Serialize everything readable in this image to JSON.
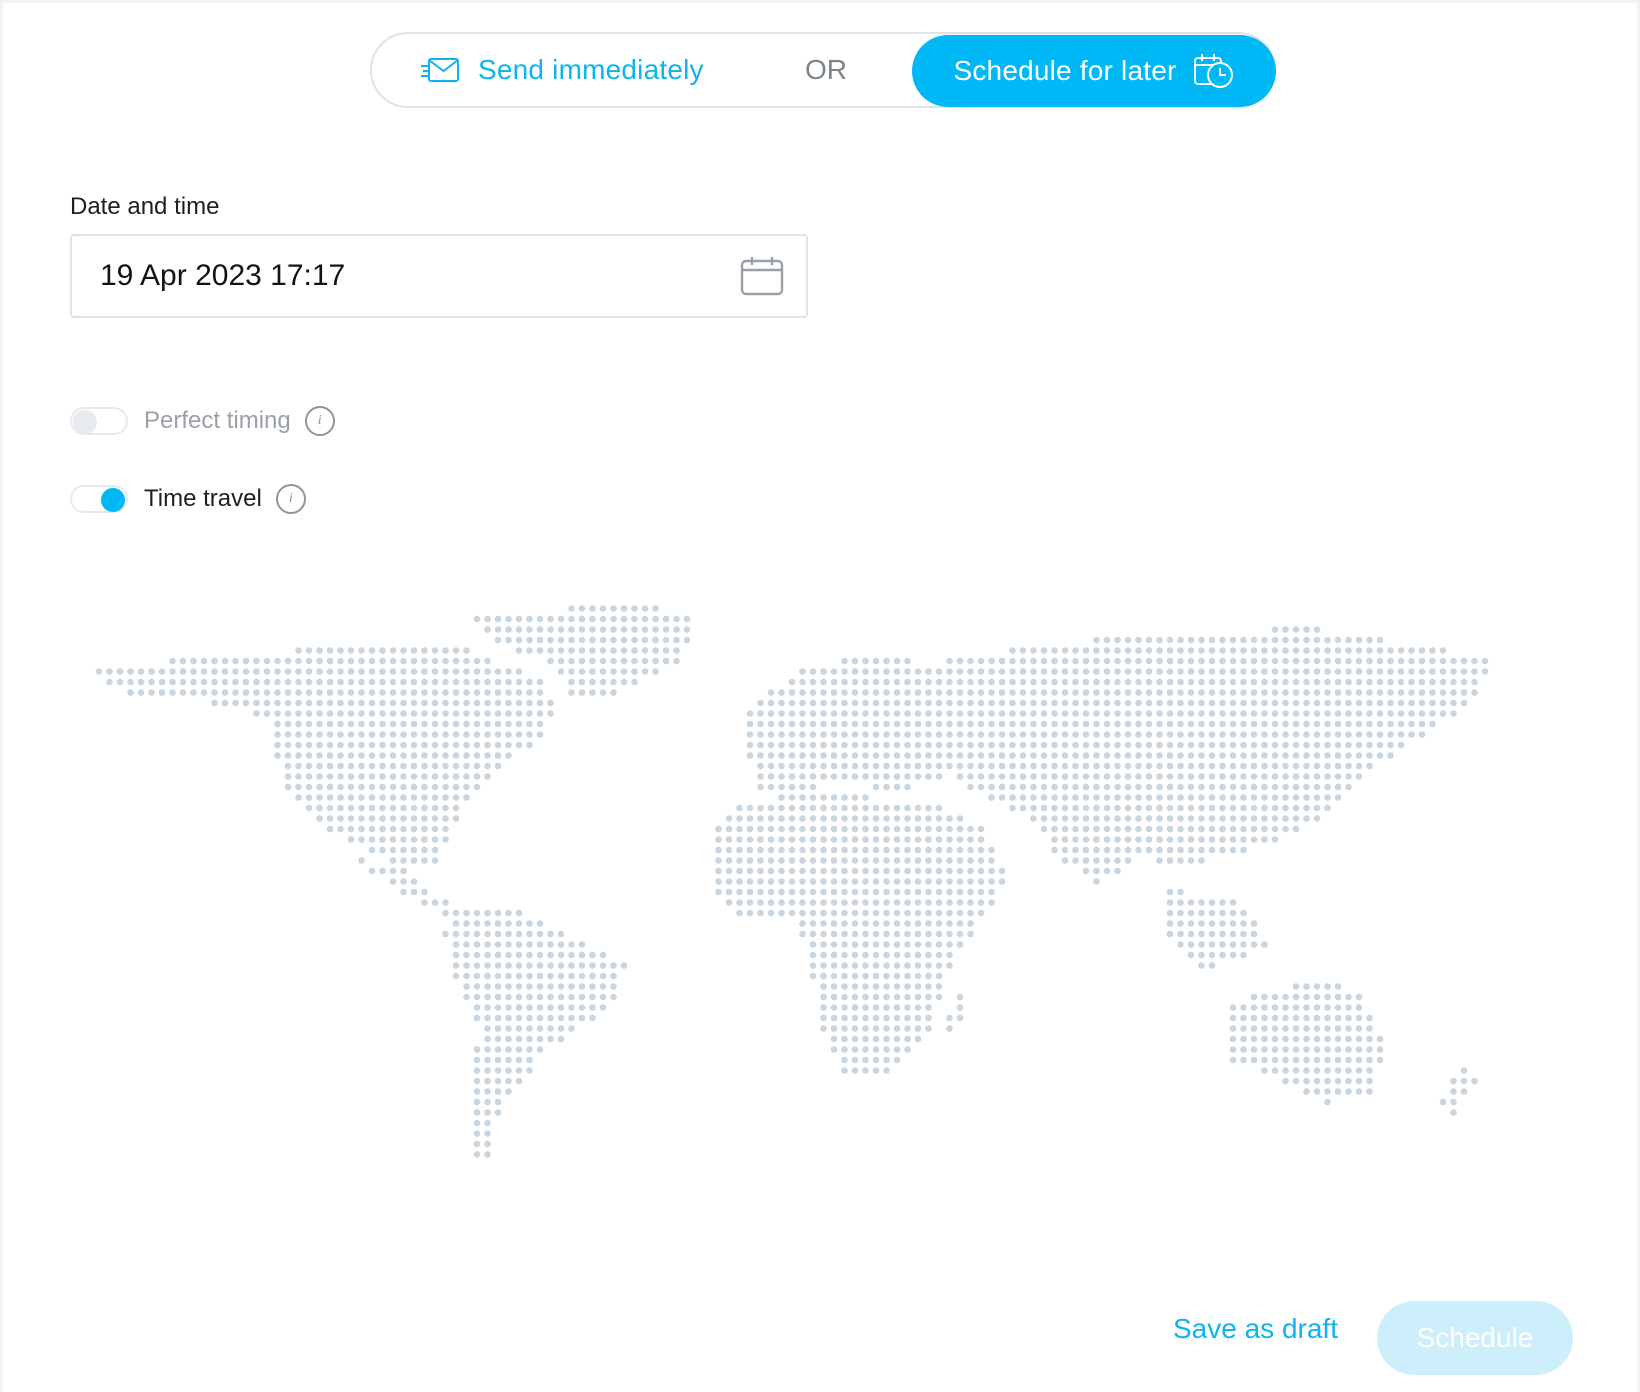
{
  "mode_toggle": {
    "send_now_label": "Send immediately",
    "separator": "OR",
    "schedule_later_label": "Schedule for later",
    "selected": "schedule_later"
  },
  "date_time": {
    "label": "Date and time",
    "value": "19 Apr 2023 17:17",
    "icon": "calendar-icon"
  },
  "options": {
    "perfect_timing": {
      "label": "Perfect timing",
      "enabled": false,
      "disabled": true,
      "icon": "info-icon"
    },
    "time_travel": {
      "label": "Time travel",
      "enabled": true,
      "icon": "info-icon"
    }
  },
  "info_glyph": "i",
  "map": {
    "name": "world-map",
    "dot_color": "#c9d5df"
  },
  "actions": {
    "save_draft_label": "Save as draft",
    "schedule_label": "Schedule"
  },
  "colors": {
    "accent": "#00b8f5",
    "accent_text": "#0db4f0",
    "disabled_button": "#cdeefb",
    "border": "#dfe3e8"
  }
}
